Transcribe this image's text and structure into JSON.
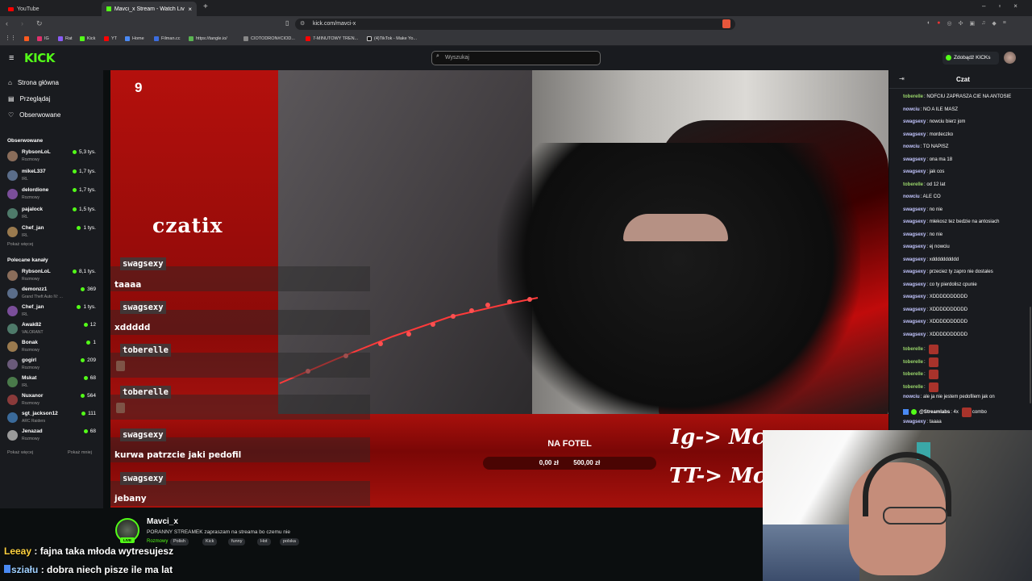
{
  "browser": {
    "tabs": [
      {
        "title": "YouTube",
        "active": false
      },
      {
        "title": "Mavci_x Stream - Watch Live",
        "active": true
      }
    ],
    "url": "kick.com/mavci-x",
    "bookmarks": [
      "IG",
      "Rat",
      "Kick",
      "YT",
      "Home",
      "Filman.cc",
      "https://tangle.io/",
      "CIOTODRON#CIOD...",
      "7-MINUTOWY TREN...",
      "(4)TikTok - Make Yo..."
    ]
  },
  "header": {
    "logo": "KICK",
    "search_placeholder": "Wyszukaj",
    "kicks_button": "Zdobądź KICKs"
  },
  "sidebar": {
    "nav": [
      {
        "label": "Strona główna",
        "icon": "home-icon"
      },
      {
        "label": "Przeglądaj",
        "icon": "browse-icon"
      },
      {
        "label": "Obserwowane",
        "icon": "heart-icon"
      }
    ],
    "followed_title": "Obserwowane",
    "followed": [
      {
        "name": "RybsonLoL",
        "category": "Rozmowy",
        "viewers": "5,3 tys."
      },
      {
        "name": "mikeL337",
        "category": "IRL",
        "viewers": "1,7 tys."
      },
      {
        "name": "delordione",
        "category": "Rozmowy",
        "viewers": "1,7 tys."
      },
      {
        "name": "pajalock",
        "category": "IRL",
        "viewers": "1,5 tys."
      },
      {
        "name": "Chef_jan",
        "category": "IRL",
        "viewers": "1 tys."
      }
    ],
    "show_more": "Pokaż więcej",
    "recommended_title": "Polecane kanały",
    "recommended": [
      {
        "name": "RybsonLoL",
        "category": "Rozmowy",
        "viewers": "8,1 tys."
      },
      {
        "name": "demonzz1",
        "category": "Grand Theft Auto IV: ...",
        "viewers": "369"
      },
      {
        "name": "Chef_jan",
        "category": "IRL",
        "viewers": "1 tys."
      },
      {
        "name": "Awak82",
        "category": "VALORANT",
        "viewers": "12"
      },
      {
        "name": "Bonak",
        "category": "Rozmowy",
        "viewers": "1"
      },
      {
        "name": "gogirl",
        "category": "Rozmowy",
        "viewers": "209"
      },
      {
        "name": "Mskat",
        "category": "IRL",
        "viewers": "68"
      },
      {
        "name": "Nuxanor",
        "category": "Rozmowy",
        "viewers": "564"
      },
      {
        "name": "sgt_jackson12",
        "category": "ARC Raiders",
        "viewers": "111"
      },
      {
        "name": "Jenazad",
        "category": "Rozmowy",
        "viewers": "68"
      }
    ],
    "show_more2": "Pokaż więcej",
    "show_less": "Pokaż mniej"
  },
  "stream_overlay": {
    "counter": "9",
    "title": "czatix",
    "messages": [
      {
        "user": "swagsexy",
        "text": "taaaa",
        "emote": false
      },
      {
        "user": "swagsexy",
        "text": "xddddd",
        "emote": false
      },
      {
        "user": "toberelle",
        "text": "",
        "emote": true
      },
      {
        "user": "toberelle",
        "text": "",
        "emote": true
      },
      {
        "user": "swagsexy",
        "text": "kurwa patrzcie jaki pedofil",
        "emote": false
      },
      {
        "user": "swagsexy",
        "text": "jebany",
        "emote": false
      }
    ],
    "goal_title": "NA FOTEL",
    "goal_current": "0,00 zł",
    "goal_target": "500,00 zł",
    "goal_progress": 0,
    "social_ig": "Ig-> Mc",
    "social_tt": "TT-> Mc"
  },
  "stream_info": {
    "streamer": "Mavci_x",
    "title": "PORANNY STREAMEK zapraszam na streama bo czemu nie",
    "category": "Rozmowy",
    "tags": [
      "Polish",
      "Kick",
      "funny",
      "Hot",
      "polska"
    ]
  },
  "captions": [
    {
      "user": "Leeay",
      "text": " : fajna taka młoda wytresujesz"
    },
    {
      "user": "sziału",
      "text": " : dobra niech pisze ile ma lat"
    }
  ],
  "chat": {
    "title": "Czat",
    "messages": [
      {
        "user": "toberelle",
        "color": "#9ad66b",
        "text": ": NOFCIU ZAPRASZA CIE NA ANTOSIE",
        "emotes": 0
      },
      {
        "user": "nowciu",
        "color": "#c3c6ff",
        "text": ": NO A ILE MASZ",
        "emotes": 0
      },
      {
        "user": "swagsexy",
        "color": "#c3c6ff",
        "text": ": nowciu bierz jom",
        "emotes": 0
      },
      {
        "user": "swagsexy",
        "color": "#c3c6ff",
        "text": ": mordeczko",
        "emotes": 0
      },
      {
        "user": "nowciu",
        "color": "#c3c6ff",
        "text": ": TO NAPISZ",
        "emotes": 0
      },
      {
        "user": "swagsexy",
        "color": "#c3c6ff",
        "text": ": ona ma 18",
        "emotes": 0
      },
      {
        "user": "swagsexy",
        "color": "#c3c6ff",
        "text": ": jak cos",
        "emotes": 0
      },
      {
        "user": "toberelle",
        "color": "#9ad66b",
        "text": ": od 12 lat",
        "emotes": 0
      },
      {
        "user": "nowciu",
        "color": "#c3c6ff",
        "text": ": ALE CO",
        "emotes": 0
      },
      {
        "user": "swagsexy",
        "color": "#c3c6ff",
        "text": ": no nie",
        "emotes": 0
      },
      {
        "user": "swagsexy",
        "color": "#c3c6ff",
        "text": ": mlekosz tez bedzie na antosiach",
        "emotes": 0
      },
      {
        "user": "swagsexy",
        "color": "#c3c6ff",
        "text": ": no nie",
        "emotes": 0
      },
      {
        "user": "swagsexy",
        "color": "#c3c6ff",
        "text": ": ej nowciu",
        "emotes": 0
      },
      {
        "user": "swagsexy",
        "color": "#c3c6ff",
        "text": ": xdddddddddd",
        "emotes": 0
      },
      {
        "user": "swagsexy",
        "color": "#c3c6ff",
        "text": ": przeciez ty zapro nie dostales",
        "emotes": 0
      },
      {
        "user": "swagsexy",
        "color": "#c3c6ff",
        "text": ": co ty pierdolisz cpunie",
        "emotes": 0
      },
      {
        "user": "swagsexy",
        "color": "#c3c6ff",
        "text": ": XDDDDDDDDDD",
        "emotes": 0
      },
      {
        "user": "swagsexy",
        "color": "#c3c6ff",
        "text": ": XDDDDDDDDDD",
        "emotes": 0
      },
      {
        "user": "swagsexy",
        "color": "#c3c6ff",
        "text": ": XDDDDDDDDDD",
        "emotes": 0
      },
      {
        "user": "swagsexy",
        "color": "#c3c6ff",
        "text": ": XDDDDDDDDDD",
        "emotes": 0
      },
      {
        "user": "toberelle",
        "color": "#9ad66b",
        "text": ":",
        "emotes": 1
      },
      {
        "user": "toberelle",
        "color": "#9ad66b",
        "text": ":",
        "emotes": 1
      },
      {
        "user": "toberelle",
        "color": "#9ad66b",
        "text": ":",
        "emotes": 1
      },
      {
        "user": "toberelle",
        "color": "#9ad66b",
        "text": ":",
        "emotes": 1
      },
      {
        "user": "nowciu",
        "color": "#c3c6ff",
        "text": ": ale ja nie jestem pedofilem jak on",
        "emotes": 0
      },
      {
        "user": "@Streamlabs",
        "color": "#ffffff",
        "text": ": 4x",
        "emotes": 1,
        "suffix": " combo"
      },
      {
        "user": "swagsexy",
        "color": "#c3c6ff",
        "text": ": taaaa",
        "emotes": 0
      }
    ]
  },
  "colors": {
    "accent": "#53fc18",
    "video_red": "#b4100d"
  }
}
